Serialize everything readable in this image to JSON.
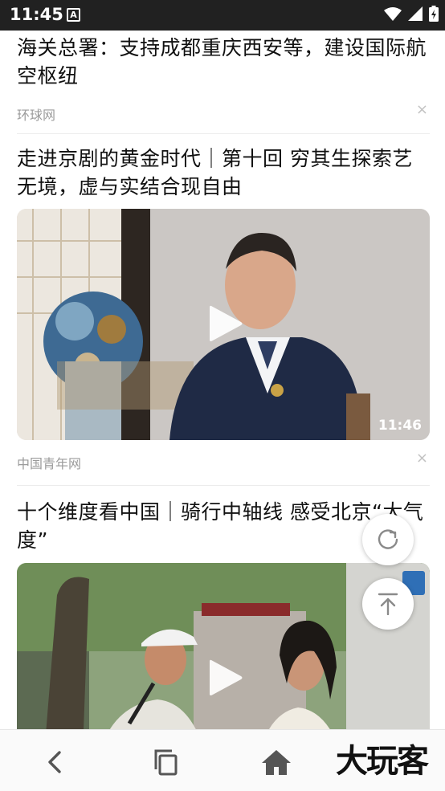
{
  "status_bar": {
    "time": "11:45",
    "notification_icon": "A"
  },
  "feed": {
    "items": [
      {
        "title": "海关总署：支持成都重庆西安等，建设国际航空枢纽",
        "source": "环球网"
      },
      {
        "title": "走进京剧的黄金时代｜第十回 穷其生探索艺无境，虚与实结合现自由",
        "source": "中国青年网",
        "duration": "11:46"
      },
      {
        "title": "十个维度看中国｜骑行中轴线 感受北京“大气度”"
      }
    ],
    "close_glyph": "×"
  },
  "watermark": "大玩客",
  "colors": {
    "status_bar": "#212121",
    "meta_text": "#9b9b9b"
  }
}
